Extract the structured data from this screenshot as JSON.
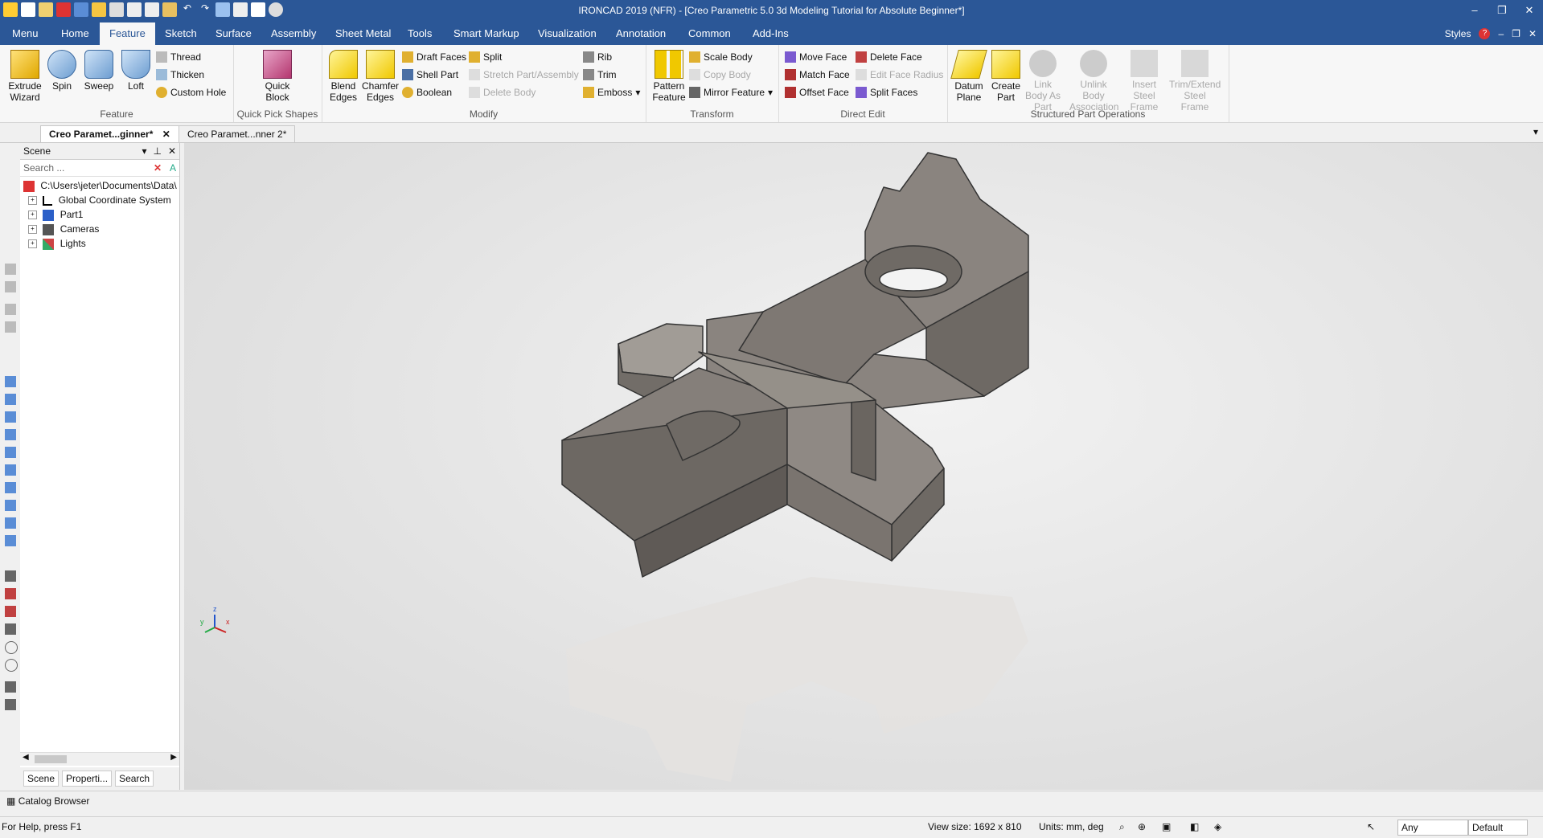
{
  "app": {
    "title": "IRONCAD 2019 (NFR) - [Creo Parametric 5.0 3d Modeling Tutorial for Absolute Beginner*]"
  },
  "window_controls": {
    "minimize": "–",
    "restore": "❐",
    "close": "✕"
  },
  "menubar": {
    "tabs": [
      "Menu",
      "Home",
      "Feature",
      "Sketch",
      "Surface",
      "Assembly",
      "Sheet Metal",
      "Tools",
      "Smart Markup",
      "Visualization",
      "Annotation",
      "Common",
      "Add-Ins"
    ],
    "active_tab": "Feature",
    "styles_label": "Styles",
    "help_icon": "?"
  },
  "ribbon": {
    "feature_group": {
      "title": "Feature",
      "big": [
        "Extrude Wizard",
        "Spin",
        "Sweep",
        "Loft"
      ],
      "small": [
        "Thread",
        "Thicken",
        "Custom Hole"
      ]
    },
    "quick_pick_group": {
      "title": "Quick Pick Shapes",
      "big": [
        "Quick Block"
      ]
    },
    "modify_group": {
      "title": "Modify",
      "big": [
        "Blend Edges",
        "Chamfer Edges"
      ],
      "small": [
        "Draft Faces",
        "Shell Part",
        "Boolean",
        "Split",
        "Stretch Part/Assembly",
        "Delete Body",
        "Rib",
        "Trim",
        "Emboss"
      ]
    },
    "transform_group": {
      "title": "Transform",
      "big": [
        "Pattern Feature"
      ],
      "small": [
        "Scale Body",
        "Copy Body",
        "Mirror Feature"
      ]
    },
    "direct_edit_group": {
      "title": "Direct Edit",
      "small": [
        "Move Face",
        "Match Face",
        "Offset Face",
        "Delete Face",
        "Edit Face Radius",
        "Split Faces"
      ]
    },
    "structured_group": {
      "title": "Structured Part Operations",
      "big": [
        "Datum Plane",
        "Create Part",
        "Link Body As Part",
        "Unlink Body Association",
        "Insert Steel Frame",
        "Trim/Extend Steel Frame"
      ]
    }
  },
  "doc_tabs": [
    "Creo Paramet...ginner*",
    "Creo Paramet...nner 2*"
  ],
  "scene_panel": {
    "title": "Scene",
    "search_placeholder": "Search ...",
    "root": "C:\\Users\\jeter\\Documents\\Data\\",
    "items": [
      "Global Coordinate System",
      "Part1",
      "Cameras",
      "Lights"
    ],
    "bottom_tabs": [
      "Scene",
      "Properti...",
      "Search"
    ]
  },
  "catalog_browser": "Catalog Browser",
  "status": {
    "help": "For Help, press F1",
    "view_size": "View size: 1692 x 810",
    "units": "Units: mm, deg",
    "select_filter": "Any",
    "style": "Default"
  },
  "triad": {
    "x": "x",
    "y": "y",
    "z": "z"
  },
  "colors": {
    "titlebar": "#2b5797",
    "part": "#7d7772",
    "part_edge": "#333333"
  }
}
